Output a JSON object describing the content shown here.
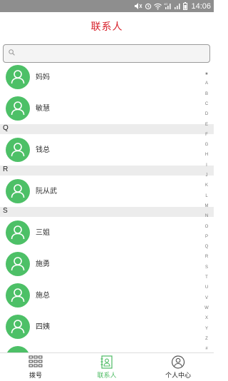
{
  "status_bar": {
    "time": "14:06",
    "network": "4G"
  },
  "header": {
    "title": "联系人"
  },
  "search": {
    "placeholder": ""
  },
  "contacts_top": [
    {
      "name": "妈妈"
    },
    {
      "name": "敏慧"
    }
  ],
  "sections": [
    {
      "letter": "Q",
      "contacts": [
        {
          "name": "钱总"
        }
      ]
    },
    {
      "letter": "R",
      "contacts": [
        {
          "name": "阮从武"
        }
      ]
    },
    {
      "letter": "S",
      "contacts": [
        {
          "name": "三姐"
        },
        {
          "name": "施勇"
        },
        {
          "name": "施总"
        },
        {
          "name": "四姨"
        }
      ]
    }
  ],
  "index_letters": [
    "★",
    "A",
    "B",
    "C",
    "D",
    "E",
    "F",
    "G",
    "H",
    "I",
    "J",
    "K",
    "L",
    "M",
    "N",
    "O",
    "P",
    "Q",
    "R",
    "S",
    "T",
    "U",
    "V",
    "W",
    "X",
    "Y",
    "Z",
    "#"
  ],
  "tabs": [
    {
      "label": "拨号",
      "icon": "dialpad-icon",
      "active": false
    },
    {
      "label": "联系人",
      "icon": "contacts-book-icon",
      "active": true
    },
    {
      "label": "个人中心",
      "icon": "person-circle-icon",
      "active": false
    }
  ],
  "colors": {
    "accent_green": "#4dc067",
    "title_red": "#d7212b",
    "status_bar": "#8e8e8e"
  }
}
